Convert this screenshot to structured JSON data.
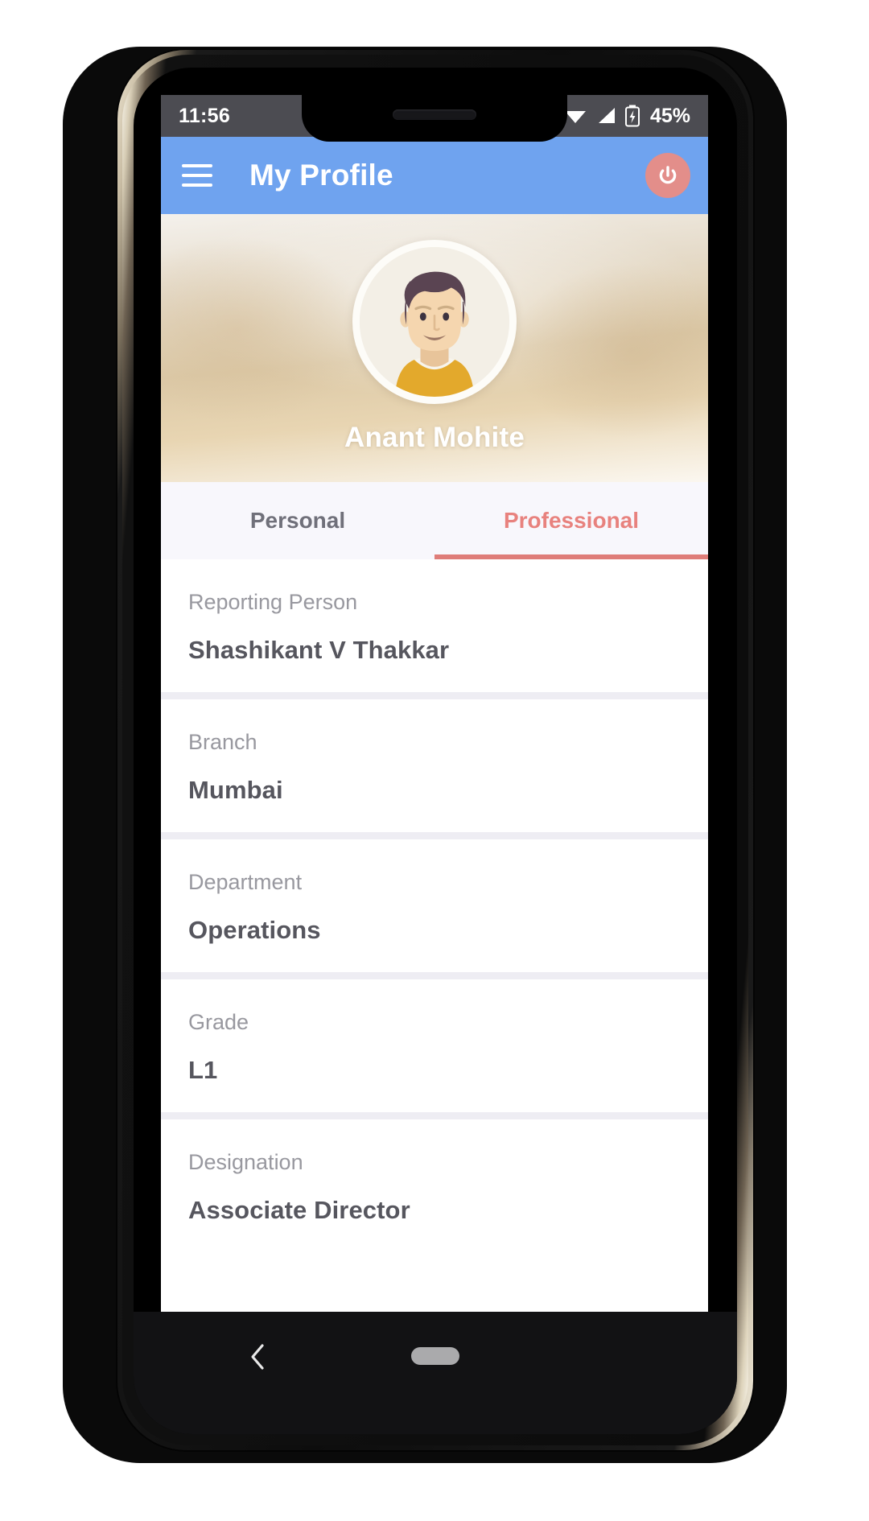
{
  "status_bar": {
    "clock": "11:56",
    "battery_percent": "45%",
    "icons": [
      "wifi-icon",
      "cellular-signal-icon",
      "battery-charging-icon"
    ]
  },
  "app_bar": {
    "menu_icon": "hamburger-menu-icon",
    "title": "My Profile",
    "power_icon": "power-icon",
    "background_color": "#6fa3ef",
    "power_button_color": "#e38e8a"
  },
  "profile": {
    "name": "Anant Mohite",
    "avatar_icon": "user-avatar-illustration"
  },
  "tabs": {
    "items": [
      {
        "label": "Personal",
        "active": false
      },
      {
        "label": "Professional",
        "active": true
      }
    ],
    "active_color": "#e8827e",
    "inactive_color": "#70707a",
    "indicator_color": "#df7d79"
  },
  "details": {
    "rows": [
      {
        "label": "Reporting Person",
        "value": "Shashikant V Thakkar"
      },
      {
        "label": "Branch",
        "value": "Mumbai"
      },
      {
        "label": "Department",
        "value": "Operations"
      },
      {
        "label": "Grade",
        "value": "L1"
      },
      {
        "label": "Designation",
        "value": "Associate Director"
      }
    ]
  },
  "nav_bar": {
    "back_icon": "back-chevron-icon",
    "home_icon": "home-pill-indicator"
  }
}
